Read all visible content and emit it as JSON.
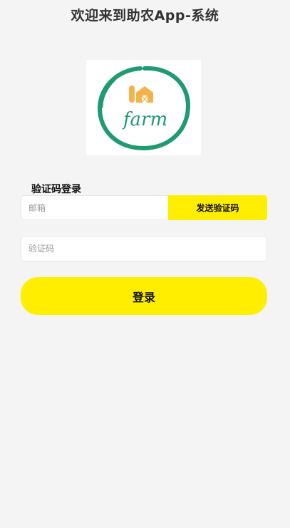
{
  "header": {
    "title": "欢迎来到助农App-系统"
  },
  "logo": {
    "text": "farm",
    "icon": "barn-silo-icon",
    "ring_color": "#1f9a72",
    "barn_color": "#f4b24a"
  },
  "login_form": {
    "section_label": "验证码登录",
    "email": {
      "placeholder": "邮箱",
      "value": ""
    },
    "send_code_label": "发送验证码",
    "code": {
      "placeholder": "验证码",
      "value": ""
    },
    "submit_label": "登录"
  },
  "colors": {
    "accent": "#ffee00",
    "background": "#f4f4f4"
  }
}
